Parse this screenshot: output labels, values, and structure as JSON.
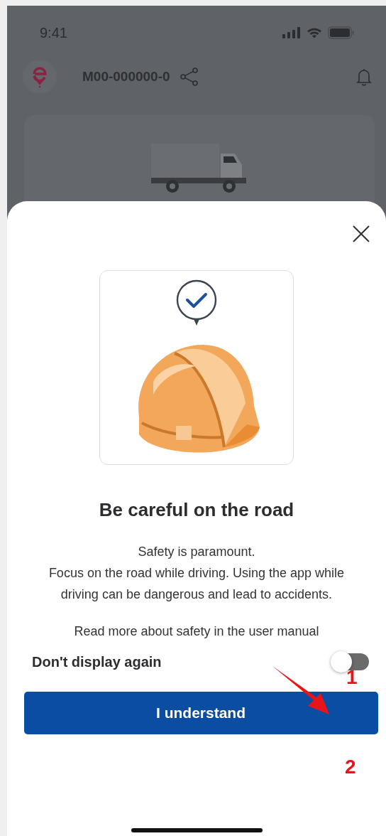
{
  "status_bar": {
    "time": "9:41"
  },
  "header": {
    "vehicle_id": "M00-000000-0"
  },
  "dialog": {
    "title": "Be careful on the road",
    "message": [
      "Safety is paramount.",
      "Focus on the road while driving. Using the app while driving can be dangerous and lead to accidents."
    ],
    "manual_text": "Read more about safety in the user manual",
    "toggle": {
      "label": "Don't display again",
      "on": false
    },
    "button": "I understand"
  },
  "annotations": [
    {
      "label": "1"
    },
    {
      "label": "2"
    }
  ]
}
